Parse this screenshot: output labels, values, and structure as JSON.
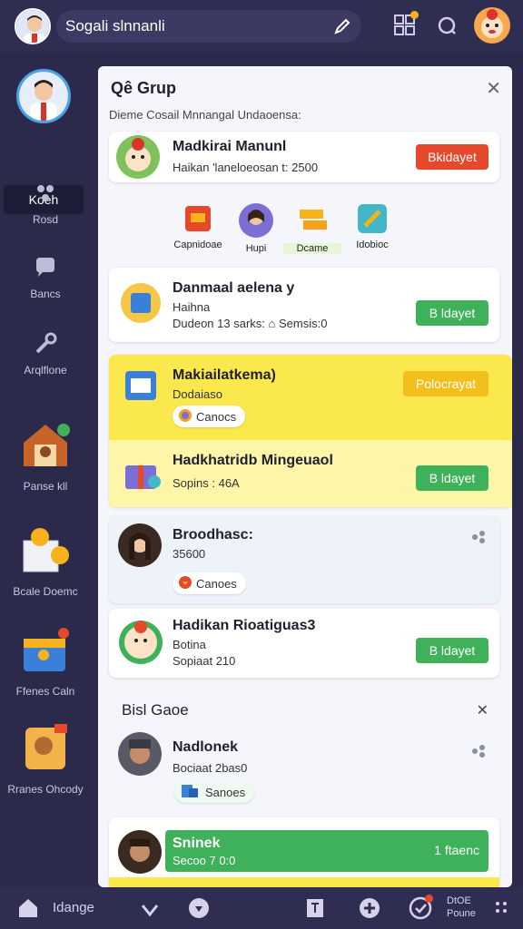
{
  "topbar": {
    "search_text": "Sogali slnnanli"
  },
  "sidebar": {
    "active_label": "Koeh",
    "items": [
      {
        "label": "Rosd"
      },
      {
        "label": "Bancs"
      },
      {
        "label": "Arqlflone"
      },
      {
        "label": "Panse kll"
      },
      {
        "label": "Bcale Doemc"
      },
      {
        "label": "Ffenes Caln"
      },
      {
        "label": "Rranes Ohcody"
      }
    ]
  },
  "panel": {
    "title": "Qê Grup",
    "subtitle": "Dieme Cosail Mnnangal Undaoensa:"
  },
  "card1": {
    "title": "Madkirai Manunl",
    "line": "Haikan 'laneloeosan t: 2500",
    "button": "Bkidayet"
  },
  "categories": [
    {
      "label": "Capnidoae"
    },
    {
      "label": "Hupi"
    },
    {
      "label": "Dcame"
    },
    {
      "label": "Idobioc"
    }
  ],
  "card2": {
    "title": "Danmaal aelena y",
    "line1": "Haihna",
    "line2": "Dudeon 13 sarks: ⌂ Semsis:0",
    "button": "B ldayet"
  },
  "card3": {
    "title": "Makiailatkema)",
    "line1": "Dodaiaso",
    "pill": "Canocs",
    "button": "Polocrayat"
  },
  "card4": {
    "title": "Hadkhatridb Mingeuaol",
    "line1": "Sopins : 46A",
    "button": "B ldayet"
  },
  "card5": {
    "title": "Broodhasc:",
    "line1": "35600",
    "pill": "Canoes"
  },
  "card6": {
    "title": "Hadikan Rioatiguas3",
    "line1": "Botina",
    "line2": "Sopiaat 210",
    "button": "B ldayet"
  },
  "section": {
    "title": "Bisl Gaoe"
  },
  "card7": {
    "title": "Nadlonek",
    "line1": "Bociaat 2bas0",
    "pill": "Sanoes"
  },
  "card8": {
    "title": "Sninek",
    "line1": "Secoo 7 0:0",
    "right": "1 ftaenc"
  },
  "bottombar": {
    "label": "Idange",
    "right_label_1": "DtOE",
    "right_label_2": "Poune"
  },
  "colors": {
    "topbar": "#2f2d52",
    "sidebar": "#2b2a4a",
    "red_button": "#e5482a",
    "green_button": "#3fb15a",
    "yellow_card": "#f9e14a"
  }
}
